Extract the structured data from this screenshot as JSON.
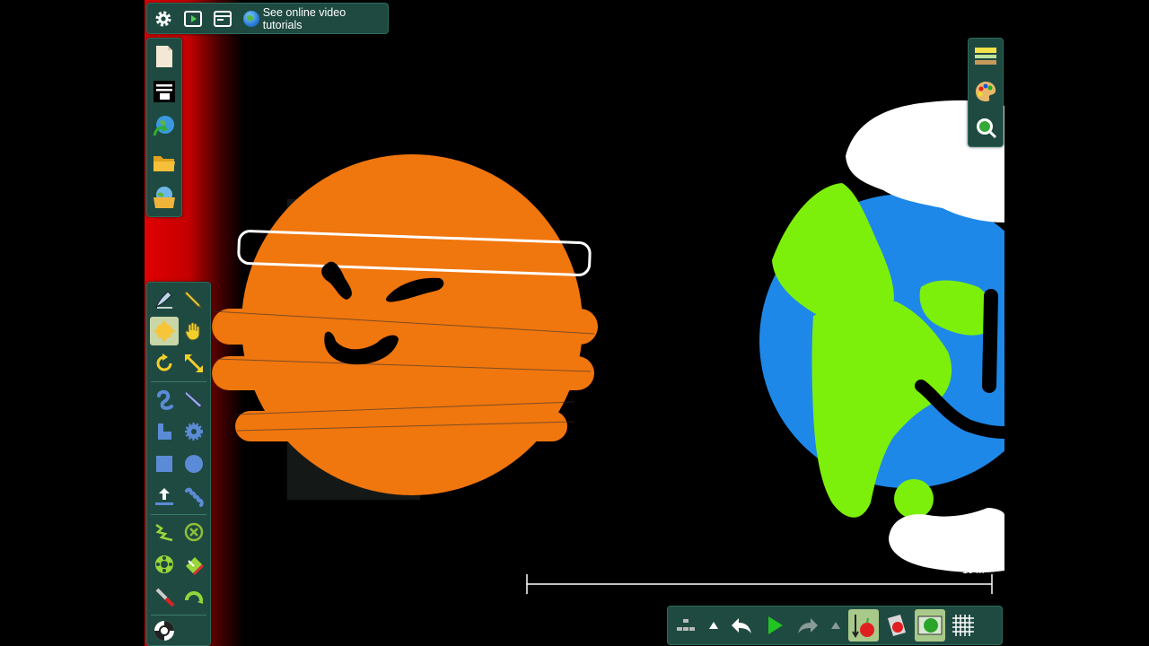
{
  "top_toolbar": {
    "tutorials_label": "See online video tutorials"
  },
  "scale_bar": {
    "label": "10 m"
  },
  "colors": {
    "panel_bg": "#1f4a41",
    "sun_orange": "#f0760e",
    "earth_blue": "#1e88e8",
    "earth_green": "#7cf00a",
    "cloud_white": "#ffffff",
    "red_glow": "#d80000"
  },
  "left_file_toolbar": {
    "items": [
      "new-scene-icon",
      "layout-icon",
      "open-online-icon",
      "open-folder-icon",
      "save-scene-icon"
    ]
  },
  "tools_palette": {
    "items": [
      "sketch-tool-icon",
      "brush-tool-icon",
      "move-tool-icon",
      "drag-hand-icon",
      "rotate-tool-icon",
      "scale-tool-icon",
      "rope-tool-icon",
      "knife-tool-icon",
      "chain-tool-icon",
      "gear-tool-icon",
      "box-tool-icon",
      "circle-tool-icon",
      "plane-tool-icon",
      "spring-tool-icon",
      "zigzag-tool-icon",
      "fixate-tool-icon",
      "wheel-tool-icon",
      "eraser-tool-icon",
      "laser-tool-icon",
      "hinge-tool-icon",
      "tracer-tool-icon"
    ]
  },
  "right_toolbar": {
    "items": [
      "layers-icon",
      "palette-icon",
      "zoom-icon"
    ]
  },
  "bottom_toolbar": {
    "items": [
      "tree-view-icon",
      "up-arrow-icon",
      "undo-icon",
      "play-icon",
      "redo-icon",
      "up-arrow-icon",
      "gravity-icon",
      "air-friction-icon",
      "background-icon",
      "grid-icon"
    ]
  }
}
